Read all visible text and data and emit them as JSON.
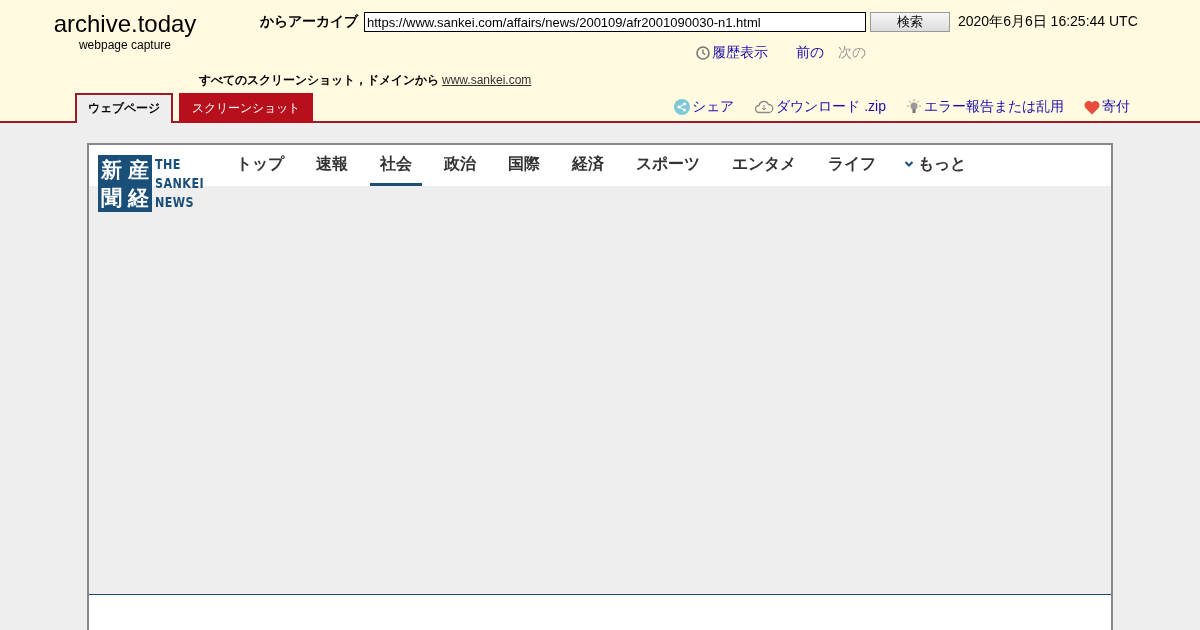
{
  "brand": {
    "title": "archive.today",
    "subtitle": "webpage capture"
  },
  "search": {
    "label": "からアーカイブ",
    "value": "https://www.sankei.com/affairs/news/200109/afr2001090030-n1.html",
    "button": "検索",
    "date": "2020年6月6日 16:25:44 UTC"
  },
  "history": [
    {
      "kind": "history",
      "label": "履歴表示",
      "disabled": false
    },
    {
      "kind": "link",
      "label": "前の",
      "disabled": false
    },
    {
      "kind": "link",
      "label": "次の",
      "disabled": true
    }
  ],
  "scope": {
    "text": "すべてのスクリーンショット，ドメインから",
    "link": "www.sankei.com"
  },
  "tabs": [
    {
      "label": "ウェブページ",
      "selected": true
    },
    {
      "label": "スクリーンショット",
      "selected": false
    }
  ],
  "actions": [
    {
      "kind": "share",
      "label": "シェア"
    },
    {
      "kind": "download",
      "label": "ダウンロード .zip"
    },
    {
      "kind": "report",
      "label": "エラー報告または乱用"
    },
    {
      "kind": "donate",
      "label": "寄付"
    }
  ],
  "site": {
    "logo_kanji": [
      "新",
      "産",
      "聞",
      "経"
    ],
    "logo_words": [
      "THE",
      "SANKEI",
      "NEWS"
    ],
    "nav": [
      {
        "label": "トップ",
        "selected": false
      },
      {
        "label": "速報",
        "selected": false
      },
      {
        "label": "社会",
        "selected": true
      },
      {
        "label": "政治",
        "selected": false
      },
      {
        "label": "国際",
        "selected": false
      },
      {
        "label": "経済",
        "selected": false
      },
      {
        "label": "スポーツ",
        "selected": false
      },
      {
        "label": "エンタメ",
        "selected": false
      },
      {
        "label": "ライフ",
        "selected": false
      }
    ],
    "more": "もっと"
  }
}
